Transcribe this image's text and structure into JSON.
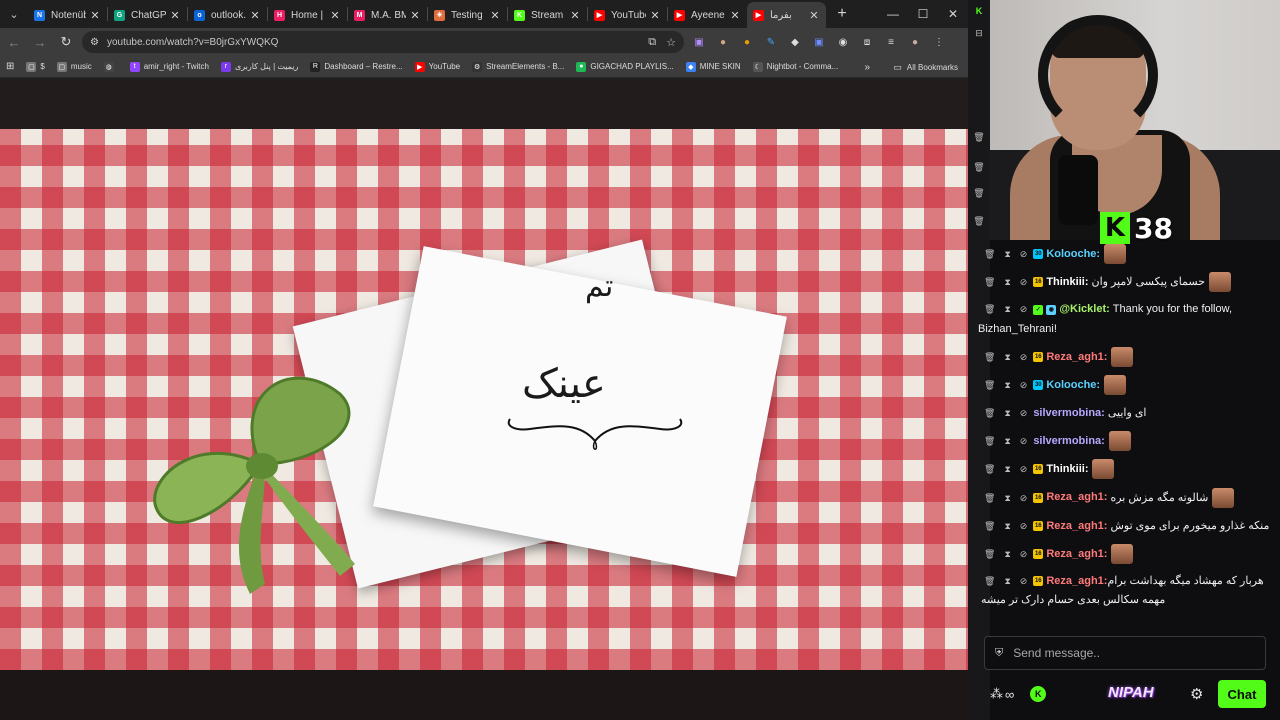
{
  "browser": {
    "tabs": [
      {
        "label": "Notenüb",
        "color": "#1a73e8",
        "icon": "N"
      },
      {
        "label": "ChatGPT",
        "color": "#10a37f",
        "icon": "G"
      },
      {
        "label": "outlook.",
        "color": "#0a64d6",
        "icon": "o"
      },
      {
        "label": "Home | I",
        "color": "#e91e63",
        "icon": "H"
      },
      {
        "label": "M.A. BMi",
        "color": "#e91e63",
        "icon": "M"
      },
      {
        "label": "Testing p",
        "color": "#e06c3c",
        "icon": "✳"
      },
      {
        "label": "Stream",
        "color": "#53fc18",
        "icon": "K"
      },
      {
        "label": "YouTube",
        "color": "#ff0000",
        "icon": "▶"
      },
      {
        "label": "Ayeene",
        "color": "#ff0000",
        "icon": "▶"
      },
      {
        "label": "بفرما",
        "color": "#ff0000",
        "icon": "▶"
      }
    ],
    "active_tab_index": 9,
    "url": "youtube.com/watch?v=B0jrGxYWQKQ",
    "bookmarks": [
      {
        "label": "$",
        "color": "#777",
        "icon": "▢"
      },
      {
        "label": "music",
        "color": "#777",
        "icon": "▢"
      },
      {
        "label": "",
        "color": "#444",
        "icon": "◍"
      },
      {
        "label": "amir_right - Twitch",
        "color": "#9146ff",
        "icon": "t"
      },
      {
        "label": "ریمیت | پنل کاربری",
        "color": "#7c3aed",
        "icon": "r"
      },
      {
        "label": "Dashboard – Restre...",
        "color": "#222",
        "icon": "R"
      },
      {
        "label": "YouTube",
        "color": "#ff0000",
        "icon": "▶"
      },
      {
        "label": "StreamElements - B...",
        "color": "#333",
        "icon": "⚙"
      },
      {
        "label": "GIGACHAD PLAYLIS...",
        "color": "#1db954",
        "icon": "●"
      },
      {
        "label": "MINE SKIN",
        "color": "#3b82f6",
        "icon": "◆"
      },
      {
        "label": "Nightbot - Comma...",
        "color": "#555",
        "icon": "☾"
      }
    ],
    "all_bookmarks": "All Bookmarks",
    "video_card": {
      "word_top": "تم",
      "word_bottom": "عینک"
    }
  },
  "chat": {
    "viewer_count": "38",
    "messages": [
      {
        "user": "Kolooche:",
        "color": "#5ad1ff",
        "badge": "#00c8ff",
        "badge_text": "30",
        "text": "",
        "emote": true
      },
      {
        "user": "Thinkiii:",
        "color": "#ffffff",
        "badge": "#f5c400",
        "badge_text": "16",
        "text": "حسمای پیکسی لامپر وان",
        "emote": true
      },
      {
        "user": "@Kicklet:",
        "color": "#a6f06b",
        "badge": "#5ad1ff",
        "badge_text": "◉",
        "badge2": "#53fc18",
        "text": "Thank you for the follow, Bizhan_Tehrani!",
        "emote": false,
        "wrap": true
      },
      {
        "user": "Reza_agh1:",
        "color": "#ff7a7a",
        "badge": "#f5c400",
        "badge_text": "16",
        "text": "",
        "emote": true
      },
      {
        "user": "Kolooche:",
        "color": "#5ad1ff",
        "badge": "#00c8ff",
        "badge_text": "30",
        "text": "",
        "emote": true
      },
      {
        "user": "silvermobina:",
        "color": "#b6a8ff",
        "badge": "",
        "badge_text": "",
        "text": "ای واییی",
        "emote": false
      },
      {
        "user": "silvermobina:",
        "color": "#b6a8ff",
        "badge": "",
        "badge_text": "",
        "text": "",
        "emote": true
      },
      {
        "user": "Thinkiii:",
        "color": "#ffffff",
        "badge": "#f5c400",
        "badge_text": "16",
        "text": "",
        "emote": true
      },
      {
        "user": "Reza_agh1:",
        "color": "#ff7a7a",
        "badge": "#f5c400",
        "badge_text": "16",
        "text": "شالوته مگه مزش بره",
        "emote": true
      },
      {
        "user": "Reza_agh1:",
        "color": "#ff7a7a",
        "badge": "#f5c400",
        "badge_text": "16",
        "text": "منکه غذارو میخورم برای موی توش",
        "emote": false
      },
      {
        "user": "Reza_agh1:",
        "color": "#ff7a7a",
        "badge": "#f5c400",
        "badge_text": "16",
        "text": "",
        "emote": true
      },
      {
        "user": "Reza_agh1:",
        "color": "#ff7a7a",
        "badge": "#f5c400",
        "badge_text": "16",
        "text": "هربار که مهشاد میگه بهداشت برام مهمه سکالس بعدی حسام دارک تر میشه",
        "emote": false,
        "wrap": true
      }
    ],
    "input_placeholder": "Send message..",
    "emote_name": "NIPAH",
    "chat_button": "Chat"
  }
}
